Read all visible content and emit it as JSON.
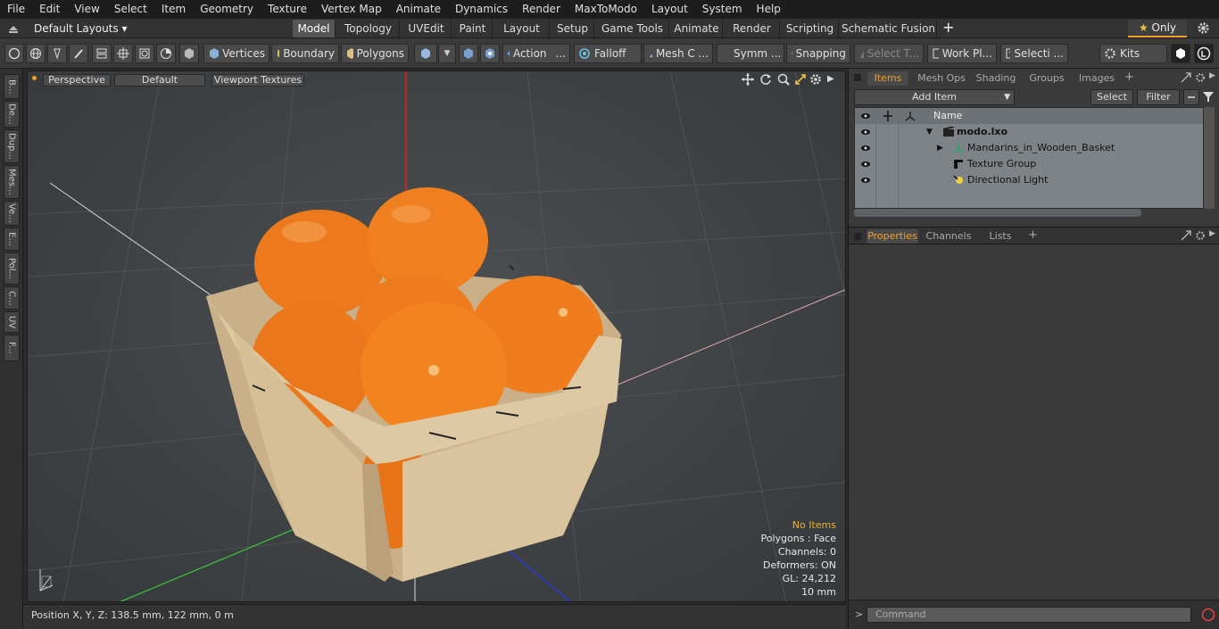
{
  "menu": [
    "File",
    "Edit",
    "View",
    "Select",
    "Item",
    "Geometry",
    "Texture",
    "Vertex Map",
    "Animate",
    "Dynamics",
    "Render",
    "MaxToModo",
    "Layout",
    "System",
    "Help"
  ],
  "layout_selector": "Default Layouts",
  "layout_tabs": [
    "Model",
    "Topology",
    "UVEdit",
    "Paint",
    "Layout",
    "Setup",
    "Game Tools",
    "Animate",
    "Render",
    "Scripting",
    "Schematic Fusion"
  ],
  "layout_tab_active": "Model",
  "only_label": "Only",
  "toolbar": {
    "vertices": "Vertices",
    "boundary": "Boundary",
    "polygons": "Polygons",
    "action": "Action",
    "action_more": "...",
    "falloff": "Falloff",
    "mesh": "Mesh C ...",
    "symmetry": "Symm ...",
    "snapping": "Snapping",
    "select_t": "Select T...",
    "work_plane": "Work Pl...",
    "selection": "Selecti ...",
    "kits": "Kits"
  },
  "left_tabs": [
    "B...",
    "De...",
    "Dup...",
    "Mes...",
    "Ve...",
    "E...",
    "Pol...",
    "C...",
    "UV",
    "F..."
  ],
  "viewport": {
    "view": "Perspective",
    "shading": "Default",
    "textures": "Viewport Textures",
    "stats": {
      "no_items": "No Items",
      "polygons": "Polygons : Face",
      "channels": "Channels: 0",
      "deformers": "Deformers: ON",
      "gl": "GL: 24,212",
      "scale": "10 mm"
    }
  },
  "status": {
    "position": "Position X, Y, Z:   138.5 mm, 122 mm, 0 m"
  },
  "items_panel": {
    "tabs": [
      "Items",
      "Mesh Ops",
      "Shading",
      "Groups",
      "Images"
    ],
    "active": "Items",
    "add_item": "Add Item",
    "select": "Select",
    "filter": "Filter",
    "name_header": "Name",
    "rows": [
      {
        "label": "modo.lxo"
      },
      {
        "label": "Mandarins_in_Wooden_Basket"
      },
      {
        "label": "Texture Group"
      },
      {
        "label": "Directional Light"
      }
    ]
  },
  "properties_panel": {
    "tabs": [
      "Properties",
      "Channels",
      "Lists"
    ],
    "active": "Properties"
  },
  "command": {
    "placeholder": "Command"
  },
  "colors": {
    "accent": "#f0a02a",
    "fruit": "#f07a1a",
    "basket": "#d9c29a"
  }
}
